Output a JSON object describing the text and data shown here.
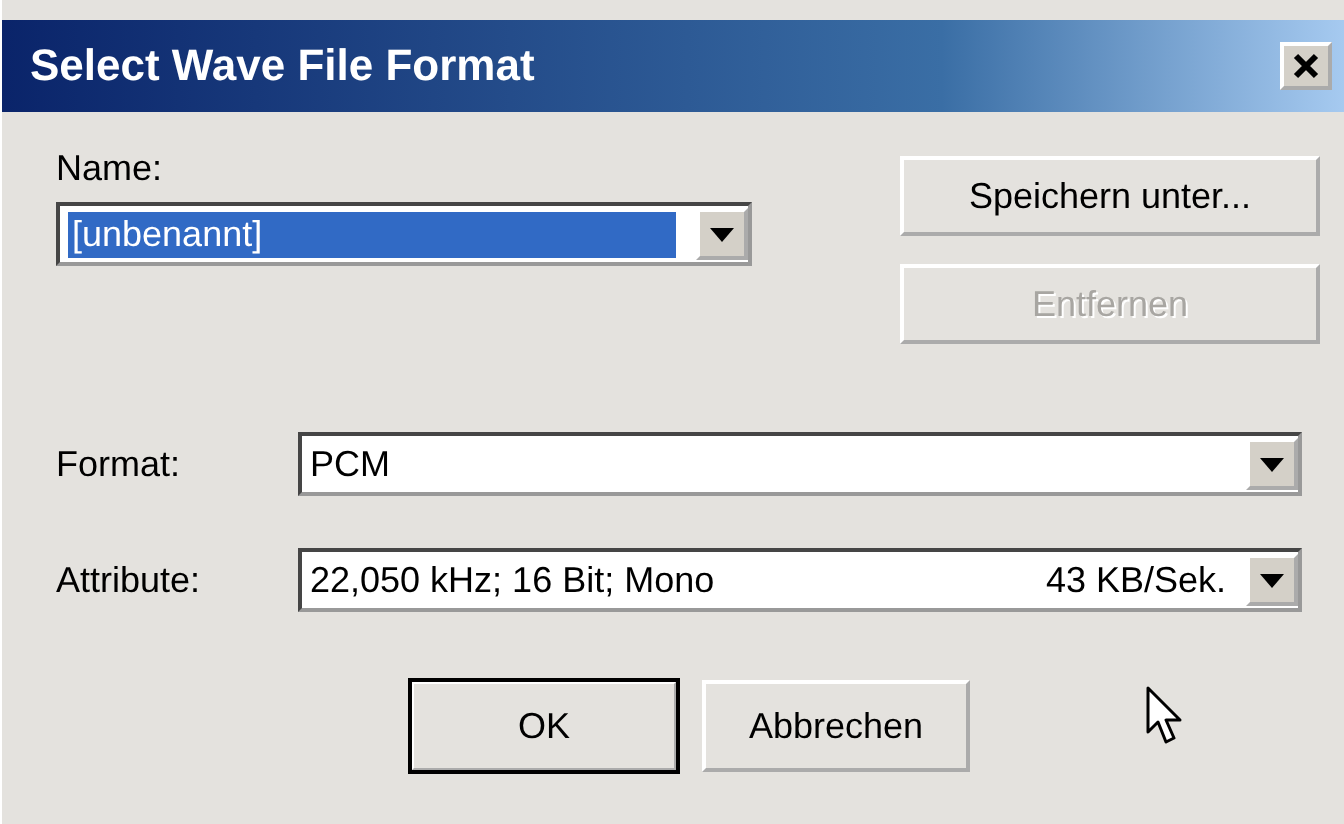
{
  "window": {
    "title": "Select Wave File Format"
  },
  "name": {
    "label": "Name:",
    "value": "[unbenannt]",
    "highlighted": true
  },
  "side_buttons": [
    {
      "label": "Speichern unter...",
      "disabled": false
    },
    {
      "label": "Entfernen",
      "disabled": true
    }
  ],
  "fields": [
    {
      "label": "Format:",
      "value": "PCM"
    },
    {
      "label": "Attribute:",
      "value": "22,050 kHz; 16 Bit; Mono",
      "rate": "43 KB/Sek."
    }
  ],
  "buttons": [
    {
      "label": "OK",
      "default": true
    },
    {
      "label": "Abbrechen",
      "default": false
    }
  ]
}
